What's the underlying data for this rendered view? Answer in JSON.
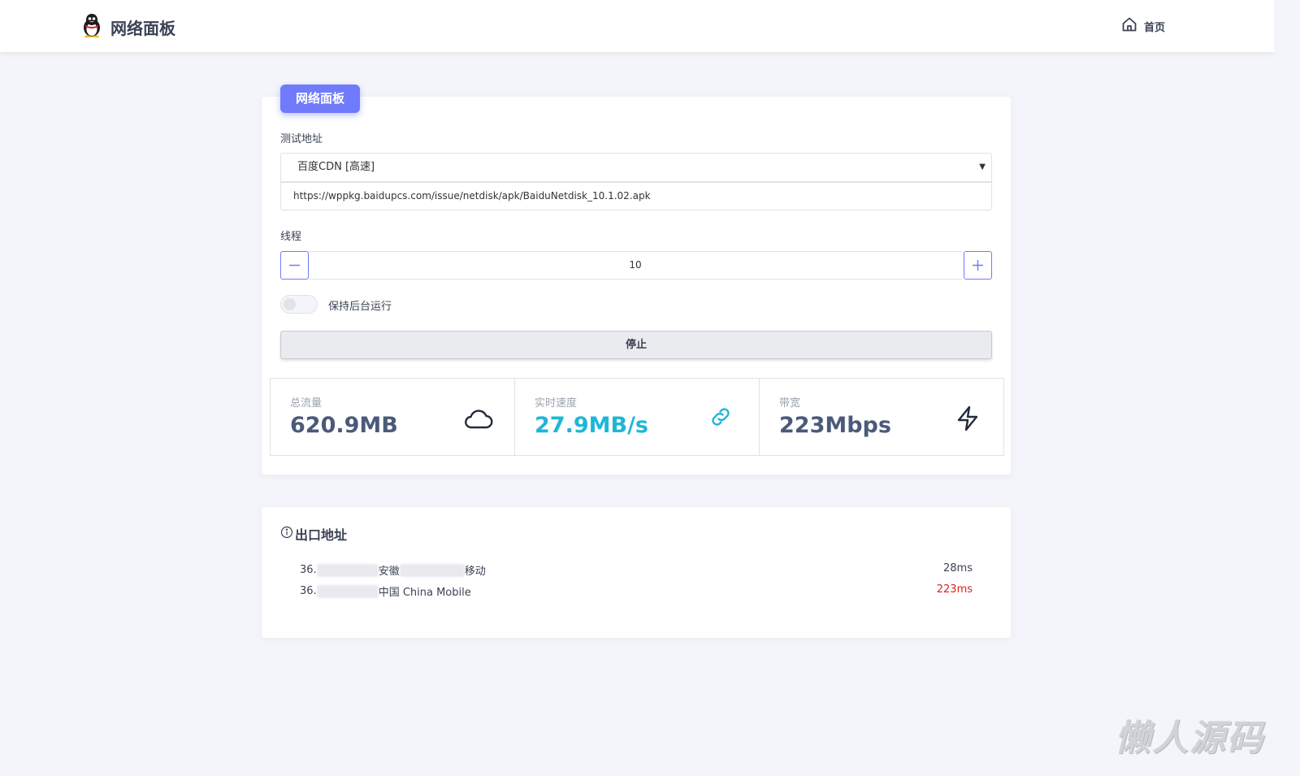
{
  "header": {
    "brand_title": "网络面板",
    "nav_home": "首页",
    "brand_icon": "penguin-icon",
    "home_icon": "home-icon"
  },
  "panel": {
    "tag": "网络面板",
    "test_address_label": "测试地址",
    "selected_source": "百度CDN [高速]",
    "url_value": "https://wppkg.baidupcs.com/issue/netdisk/apk/BaiduNetdisk_10.1.02.apk",
    "threads_label": "线程",
    "threads_value": "10",
    "keep_background_label": "保持后台运行",
    "keep_background_on": false,
    "stop_button": "停止"
  },
  "stats": [
    {
      "label": "总流量",
      "value": "620.9MB",
      "icon": "cloud-icon",
      "color": "#4b5a7a"
    },
    {
      "label": "实时速度",
      "value": "27.9MB/s",
      "icon": "link-icon",
      "color": "#1fb6d8"
    },
    {
      "label": "带宽",
      "value": "223Mbps",
      "icon": "lightning-icon",
      "color": "#4b5a7a"
    }
  ],
  "exit": {
    "title": "出口地址",
    "icon": "info-icon",
    "rows": [
      {
        "ip_prefix": "36.",
        "region": "安徽",
        "isp": "移动",
        "latency": "28ms",
        "latency_color": "#3b4254"
      },
      {
        "ip_prefix": "36.",
        "region": "中国 China Mobile",
        "isp": "",
        "latency": "223ms",
        "latency_color": "#e02020"
      }
    ]
  },
  "watermark": "懒人源码",
  "colors": {
    "accent": "#6f7bfb",
    "speed": "#1fb6d8",
    "latency_high": "#e02020"
  }
}
